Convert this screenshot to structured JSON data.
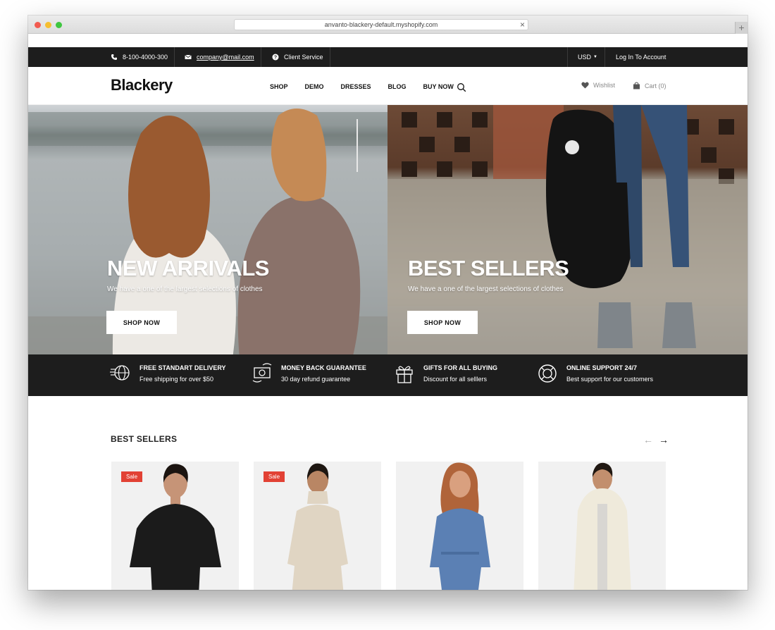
{
  "browser": {
    "url": "anvanto-blackery-default.myshopify.com"
  },
  "topbar": {
    "phone": "8-100-4000-300",
    "email": "company@mail.com",
    "client_service": "Client Service",
    "currency": "USD",
    "login": "Log In To Account"
  },
  "header": {
    "logo": "Blackery",
    "nav": [
      "SHOP",
      "DEMO",
      "DRESSES",
      "BLOG",
      "BUY NOW"
    ],
    "wishlist": "Wishlist",
    "cart": "Cart (0)"
  },
  "hero": {
    "panels": [
      {
        "title": "NEW ARRIVALS",
        "subtitle": "We have a one of the largest selections of clothes",
        "button": "SHOP NOW"
      },
      {
        "title": "BEST SELLERS",
        "subtitle": "We have a one of the largest selections of clothes",
        "button": "SHOP NOW"
      }
    ]
  },
  "features": [
    {
      "icon": "globe-delivery-icon",
      "title": "FREE STANDART DELIVERY",
      "subtitle": "Free shipping for over $50"
    },
    {
      "icon": "money-back-icon",
      "title": "MONEY BACK GUARANTEE",
      "subtitle": "30 day refund guarantee"
    },
    {
      "icon": "gift-icon",
      "title": "GIFTS FOR ALL BUYING",
      "subtitle": "Discount for all selllers"
    },
    {
      "icon": "lifebuoy-icon",
      "title": "ONLINE SUPPORT 24/7",
      "subtitle": "Best support for our customers"
    }
  ],
  "best_sellers": {
    "title": "BEST SELLERS",
    "prev": "←",
    "next": "→",
    "products": [
      {
        "badge": "Sale",
        "color": "#1b1b1b"
      },
      {
        "badge": "Sale",
        "color": "#e0d5c3"
      },
      {
        "badge": "",
        "color": "#5b80b4"
      },
      {
        "badge": "",
        "color": "#efeadb"
      }
    ]
  },
  "colors": {
    "dark_bar": "#1d1d1d",
    "sale_badge": "#e24134"
  }
}
